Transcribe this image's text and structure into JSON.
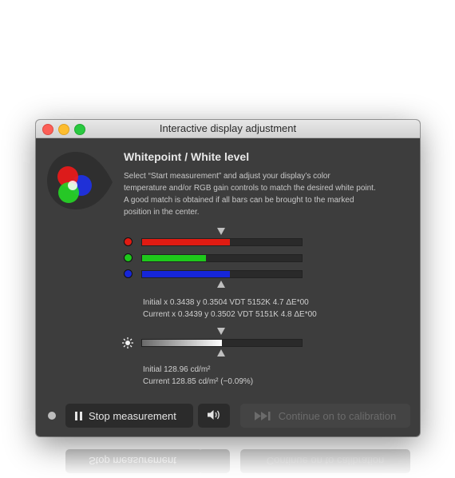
{
  "window": {
    "title": "Interactive display adjustment"
  },
  "content": {
    "heading": "Whitepoint / White level",
    "description_lines": [
      "Select “Start measurement” and adjust your display’s color",
      "temperature and/or RGB gain controls to match the desired white point.",
      "A good match is obtained if all bars can be brought to the marked",
      "position in the center."
    ],
    "color_bars": [
      {
        "name": "red",
        "color": "#e01b12",
        "fill_fraction": 0.55
      },
      {
        "name": "green",
        "color": "#1ec81b",
        "fill_fraction": 0.4
      },
      {
        "name": "blue",
        "color": "#1626d8",
        "fill_fraction": 0.55
      }
    ],
    "whitepoint_info": {
      "initial": "Initial x 0.3438 y 0.3504 VDT 5152K 4.7 ΔE*00",
      "current": "Current x 0.3439 y 0.3502 VDT 5151K 4.8 ΔE*00"
    },
    "brightness_bar": {
      "icon": "brightness-icon",
      "fill_fraction": 0.5
    },
    "luminance_info": {
      "initial": "Initial 128.96 cd/m²",
      "current": "Current 128.85 cd/m² (−0.09%)"
    }
  },
  "footer": {
    "stop_button": "Stop measurement",
    "sound_icon": "speaker-icon",
    "continue_button": "Continue on to calibration",
    "continue_icon": "skip-forward-icon"
  },
  "colors": {
    "window_bg": "#3d3d3d",
    "button_bg": "#2b2b2b",
    "disabled_text": "#6b6b6b"
  }
}
